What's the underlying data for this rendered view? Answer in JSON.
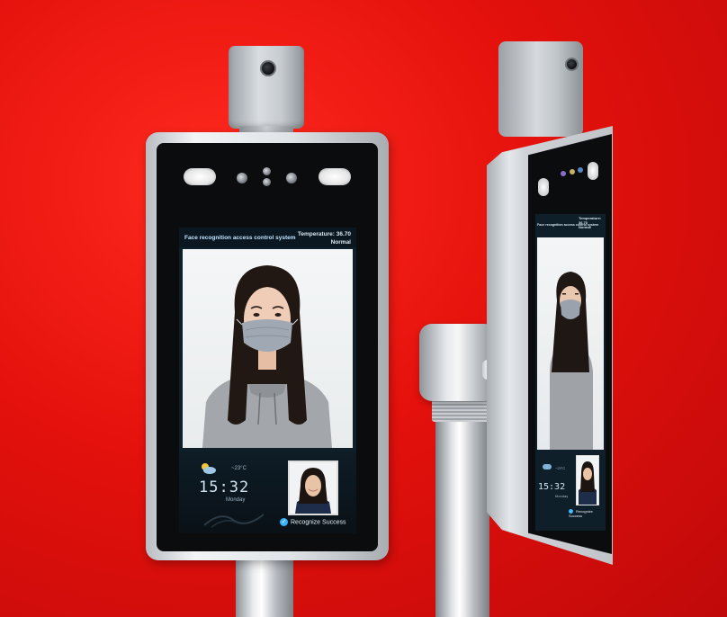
{
  "front_device": {
    "header_title": "Face recognition access control system",
    "temperature_label": "Temperature: 36.70",
    "temperature_status": "Normal",
    "weather_temp": "~23°C",
    "clock": "15:32",
    "weekday": "Monday",
    "recognize_text": "Recognize Success"
  },
  "side_device": {
    "header_title": "Face recognition access control system",
    "temperature_label": "Temperature: 36.70",
    "temperature_status": "Normal",
    "weather_temp": "~23°C",
    "clock": "15:32",
    "weekday": "Monday",
    "recognize_text": "Recognize Success"
  },
  "colors": {
    "background": "#e4110c",
    "screen": "#0f1f2a",
    "accent": "#35b3ff",
    "frame_silver": "#dfe3e6"
  }
}
